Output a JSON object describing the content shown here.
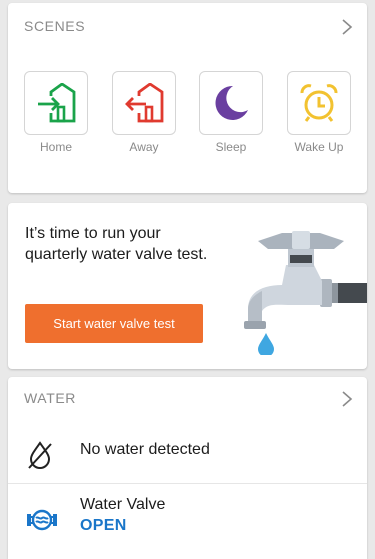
{
  "scenes": {
    "header": "SCENES",
    "items": [
      {
        "label": "Home",
        "icon": "home-arrow-in-icon",
        "color": "#1aa34a"
      },
      {
        "label": "Away",
        "icon": "home-arrow-out-icon",
        "color": "#e03a2f"
      },
      {
        "label": "Sleep",
        "icon": "moon-icon",
        "color": "#6a3fa0"
      },
      {
        "label": "Wake Up",
        "icon": "alarm-clock-icon",
        "color": "#f2c230"
      }
    ]
  },
  "promo": {
    "message": "It’s time to run your quarterly water valve test.",
    "button_label": "Start water valve test",
    "button_color": "#ef6f2e",
    "illustration": "faucet-icon"
  },
  "water": {
    "header": "WATER",
    "rows": [
      {
        "title": "No water detected",
        "icon": "no-water-drop-icon"
      },
      {
        "title": "Water Valve",
        "status": "OPEN",
        "icon": "water-valve-icon",
        "status_color": "#1a76c9"
      }
    ]
  }
}
